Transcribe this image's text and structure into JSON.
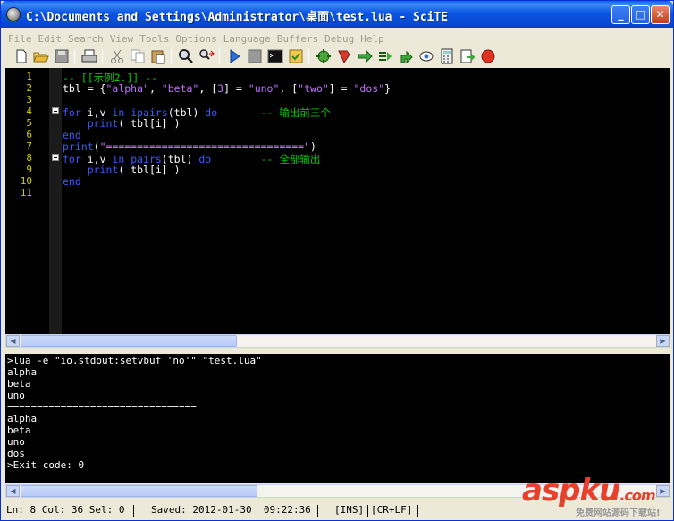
{
  "window": {
    "title": "C:\\Documents and Settings\\Administrator\\桌面\\test.lua - SciTE"
  },
  "titlebar_buttons": {
    "minimize": "_",
    "maximize": "□",
    "close": "✕"
  },
  "menu": [
    "File",
    "Edit",
    "Search",
    "View",
    "Tools",
    "Options",
    "Language",
    "Buffers",
    "Debug",
    "Help"
  ],
  "toolbar": [
    "new-icon",
    "open-icon",
    "save-icon",
    "print-icon",
    "cut-icon",
    "copy-icon",
    "paste-icon",
    "find-icon",
    "replace-icon",
    "compile-icon",
    "stop-icon",
    "console-icon",
    "build-icon",
    "go-icon",
    "debug-icon",
    "next-icon",
    "step-icon",
    "stepout-icon",
    "watch-icon",
    "calculator-icon",
    "export-icon",
    "abort-icon"
  ],
  "editor": {
    "line_numbers": [
      "1",
      "2",
      "3",
      "4",
      "5",
      "6",
      "7",
      "8",
      "9",
      "10",
      "11"
    ],
    "lines": [
      [
        {
          "t": "-- [[示例2.]] --",
          "c": "comment"
        }
      ],
      [
        {
          "t": "tbl = {",
          "c": ""
        },
        {
          "t": "\"alpha\"",
          "c": "str"
        },
        {
          "t": ", ",
          "c": ""
        },
        {
          "t": "\"beta\"",
          "c": "str"
        },
        {
          "t": ", [",
          "c": ""
        },
        {
          "t": "3",
          "c": "num"
        },
        {
          "t": "] = ",
          "c": ""
        },
        {
          "t": "\"uno\"",
          "c": "str"
        },
        {
          "t": ", [",
          "c": ""
        },
        {
          "t": "\"two\"",
          "c": "str"
        },
        {
          "t": "] = ",
          "c": ""
        },
        {
          "t": "\"dos\"",
          "c": "str"
        },
        {
          "t": "}",
          "c": ""
        }
      ],
      [],
      [
        {
          "t": "for",
          "c": "kw"
        },
        {
          "t": " i,v ",
          "c": ""
        },
        {
          "t": "in",
          "c": "kw"
        },
        {
          "t": " ",
          "c": ""
        },
        {
          "t": "ipairs",
          "c": "fn"
        },
        {
          "t": "(tbl) ",
          "c": ""
        },
        {
          "t": "do",
          "c": "kw"
        },
        {
          "t": "       ",
          "c": ""
        },
        {
          "t": "-- 输出前三个",
          "c": "comment"
        }
      ],
      [
        {
          "t": "    ",
          "c": ""
        },
        {
          "t": "print",
          "c": "fn"
        },
        {
          "t": "( tbl[i] )",
          "c": ""
        }
      ],
      [
        {
          "t": "end",
          "c": "kw"
        }
      ],
      [
        {
          "t": "print",
          "c": "fn"
        },
        {
          "t": "(",
          "c": ""
        },
        {
          "t": "\"================================\"",
          "c": "str"
        },
        {
          "t": ")",
          "c": ""
        }
      ],
      [
        {
          "t": "for",
          "c": "kw"
        },
        {
          "t": " i,v ",
          "c": ""
        },
        {
          "t": "in",
          "c": "kw"
        },
        {
          "t": " ",
          "c": ""
        },
        {
          "t": "pairs",
          "c": "fn"
        },
        {
          "t": "(tbl) ",
          "c": ""
        },
        {
          "t": "do",
          "c": "kw"
        },
        {
          "t": "        ",
          "c": ""
        },
        {
          "t": "-- 全部输出",
          "c": "comment"
        }
      ],
      [
        {
          "t": "    ",
          "c": ""
        },
        {
          "t": "print",
          "c": "fn"
        },
        {
          "t": "( tbl[i] )",
          "c": ""
        }
      ],
      [
        {
          "t": "end",
          "c": "kw"
        }
      ],
      []
    ],
    "fold_lines": [
      4,
      8
    ]
  },
  "output": {
    "lines": [
      ">lua -e \"io.stdout:setvbuf 'no'\" \"test.lua\"",
      "alpha",
      "beta",
      "uno",
      "================================",
      "alpha",
      "beta",
      "uno",
      "dos",
      ">Exit code: 0"
    ]
  },
  "status": {
    "position": "Ln: 8 Col: 36 Sel: 0",
    "saved": "Saved: 2012-01-30  09:22:36",
    "mode": "[INS]",
    "eol": "[CR+LF]"
  },
  "watermark": {
    "brand": "aspku",
    "suffix": ".com",
    "tagline": "免费网站源码下载站!"
  },
  "colors": {
    "title_bar": "#0a5ee8",
    "comment": "#00cc00",
    "keyword": "#3b5bff",
    "string": "#c070ff",
    "line_number": "#cccc00"
  }
}
